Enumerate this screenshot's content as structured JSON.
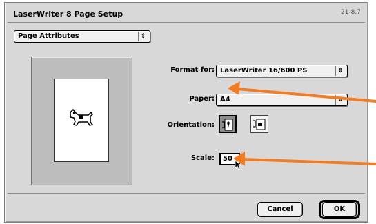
{
  "dialog": {
    "title": "LaserWriter 8 Page Setup",
    "version": "21-8.7"
  },
  "section_popup": {
    "value": "Page Attributes",
    "arrow": "⇕"
  },
  "format_for": {
    "label": "Format for:",
    "value": "LaserWriter 16/600 PS",
    "arrow": "⇕"
  },
  "paper": {
    "label": "Paper:",
    "value": "A4",
    "arrow": "⇕"
  },
  "orientation": {
    "label": "Orientation:",
    "options": [
      {
        "name": "portrait",
        "selected": true
      },
      {
        "name": "landscape",
        "selected": false
      }
    ]
  },
  "scale": {
    "label": "Scale:",
    "value": "50"
  },
  "buttons": {
    "cancel": "Cancel",
    "ok": "OK"
  },
  "annotations": {
    "arrow_color": "#f47c20"
  },
  "icons": [
    "dogcow-icon",
    "portrait-orientation-icon",
    "landscape-orientation-icon",
    "mouse-cursor-icon"
  ]
}
